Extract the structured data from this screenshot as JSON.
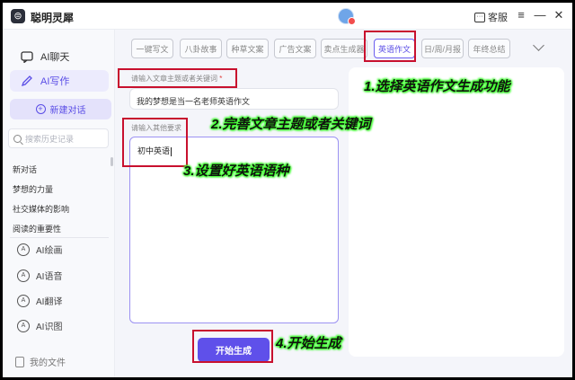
{
  "app": {
    "title": "聪明灵犀",
    "logo_glyph": "⊜"
  },
  "titlebar": {
    "support_label": "客服",
    "menu_glyph": "≡",
    "minimize_glyph": "—",
    "close_glyph": "✕"
  },
  "sidebar": {
    "nav": [
      {
        "label": "AI聊天",
        "icon": "chat-icon",
        "active": false
      },
      {
        "label": "AI写作",
        "icon": "pen-icon",
        "active": true
      }
    ],
    "new_chat_label": "新建对话",
    "search_placeholder": "搜索历史记录",
    "history": [
      "新对话",
      "梦想的力量",
      "社交媒体的影响",
      "阅读的重要性"
    ],
    "tools": [
      {
        "label": "AI绘画",
        "icon": "paint-icon",
        "glyph": "A"
      },
      {
        "label": "AI语音",
        "icon": "voice-icon",
        "glyph": "A"
      },
      {
        "label": "AI翻译",
        "icon": "translate-icon",
        "glyph": "A"
      },
      {
        "label": "AI识图",
        "icon": "image-recognition-icon",
        "glyph": "A"
      }
    ],
    "files_label": "我的文件"
  },
  "tabs": [
    "一键写文",
    "八卦故事",
    "种草文案",
    "广告文案",
    "卖点生成器",
    "英语作文",
    "日/周/月报",
    "年终总结"
  ],
  "active_tab": "英语作文",
  "form": {
    "topic_label": "请输入文章主题或者关键词",
    "required_mark": "*",
    "topic_value": "我的梦想是当一名老师英语作文",
    "requirements_label": "请输入其他要求",
    "requirements_value": "初中英语",
    "start_button": "开始生成"
  },
  "annotations": {
    "step1": "1.选择英语作文生成功能",
    "step2": "2.完善文章主题或者关键词",
    "step3": "3.设置好英语语种",
    "step4": "4.开始生成"
  },
  "colors": {
    "accent": "#5f50ea",
    "annotation_box": "#c8102e",
    "annotation_glow": "#3cff2c"
  }
}
